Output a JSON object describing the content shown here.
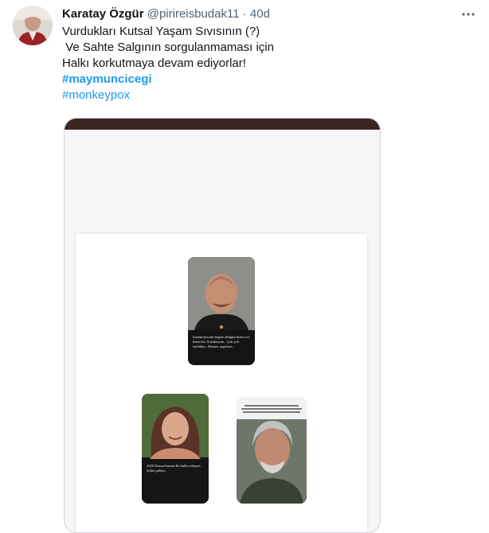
{
  "tweet": {
    "author_name": "Karatay Özgür",
    "handle": "@pirireisbudak11",
    "separator": "·",
    "time": "40d",
    "lines": [
      "Vurdukları Kutsal Yaşam Sıvısının (?)",
      " Ve Sahte Salgının sorgulanmaması için",
      "Halkı korkutmaya devam ediyorlar!"
    ],
    "hashtags": [
      "#maymuncicegi",
      "#monkeypox"
    ]
  },
  "icons": {
    "more": "more-horizontal-icon"
  },
  "media": {
    "story_one_caption": "Inanamiyorum bugün aldigim ikinci aci haber bu. Sokaktayim.. Çok çok üzüldüm.. Basiniz sagolsun..",
    "story_two_caption": "ASSİ Kemal hanım Bu haller nihayet.. Şokta gülüm..",
    "colors": {
      "topbar": "#3c2622",
      "link": "#1d9bf0",
      "muted": "#536471"
    }
  }
}
